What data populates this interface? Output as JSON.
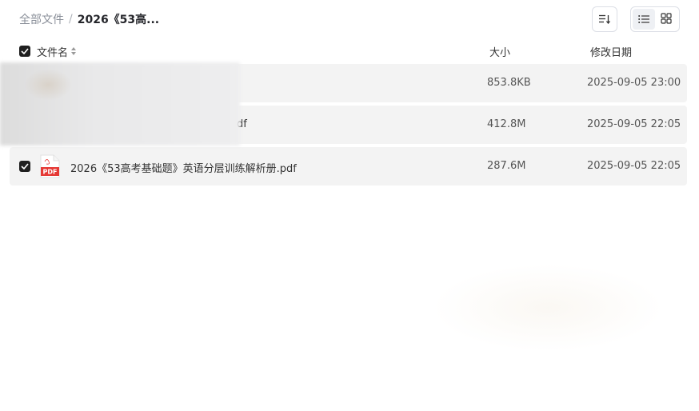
{
  "breadcrumb": {
    "root": "全部文件",
    "separator": "/",
    "current": "2026《53高..."
  },
  "toolbar": {
    "sort_icon": "sort-lines-icon",
    "view_list_icon": "list-view-icon",
    "view_grid_icon": "grid-view-icon",
    "active_view": "list"
  },
  "table": {
    "columns": {
      "name": "文件名",
      "size": "大小",
      "date": "修改日期"
    },
    "header_checked": true,
    "rows": [
      {
        "name": "",
        "size": "853.8KB",
        "date": "2025-09-05 23:00",
        "checked": false,
        "redacted": true
      },
      {
        "name": "df",
        "size": "412.8M",
        "date": "2025-09-05 22:05",
        "checked": false,
        "redacted": true
      },
      {
        "name": "2026《53高考基础题》英语分层训练解析册.pdf",
        "size": "287.6M",
        "date": "2025-09-05 22:05",
        "checked": true,
        "icon": "pdf-file-icon",
        "icon_label": "PDF"
      }
    ]
  },
  "colors": {
    "row_bg": "#f3f3f3",
    "checkbox": "#1f1f1f",
    "pdf_red": "#e53935"
  }
}
